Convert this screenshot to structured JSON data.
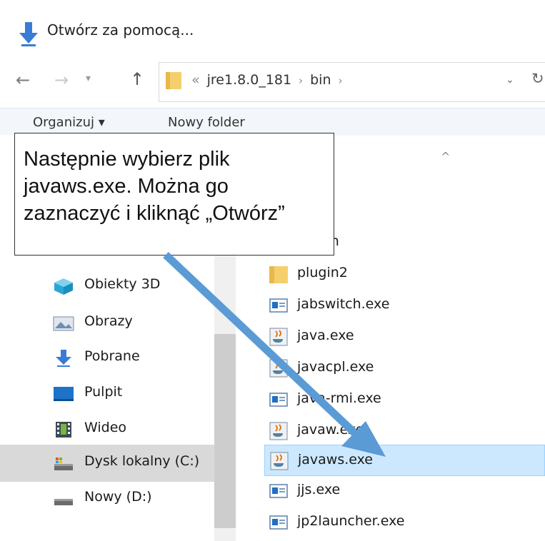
{
  "title_bar": {
    "text": "Otwórz za pomocą..."
  },
  "address": {
    "prefix": "«",
    "crumbs": [
      "jre1.8.0_181",
      "bin"
    ]
  },
  "toolbar": {
    "organize_label": "Organizuj ▾",
    "new_folder_label": "Nowy folder"
  },
  "nav_items": [
    {
      "label": "Obiekty 3D",
      "icon": "3d-objects-icon"
    },
    {
      "label": "Obrazy",
      "icon": "pictures-icon"
    },
    {
      "label": "Pobrane",
      "icon": "downloads-icon"
    },
    {
      "label": "Pulpit",
      "icon": "desktop-icon"
    },
    {
      "label": "Wideo",
      "icon": "video-icon"
    },
    {
      "label": "Dysk lokalny (C:)",
      "icon": "local-disk-icon",
      "selected": true
    },
    {
      "label": "Nowy (D:)",
      "icon": "drive-icon"
    }
  ],
  "files": [
    {
      "name": "plugin",
      "icon": "folder-icon"
    },
    {
      "name": "plugin2",
      "icon": "folder-icon"
    },
    {
      "name": "jabswitch.exe",
      "icon": "exe-icon"
    },
    {
      "name": "java.exe",
      "icon": "java-icon"
    },
    {
      "name": "javacpl.exe",
      "icon": "java-icon"
    },
    {
      "name": "java-rmi.exe",
      "icon": "exe-icon"
    },
    {
      "name": "javaw.exe",
      "icon": "java-icon"
    },
    {
      "name": "javaws.exe",
      "icon": "java-icon",
      "selected": true
    },
    {
      "name": "jjs.exe",
      "icon": "exe-icon"
    },
    {
      "name": "jp2launcher.exe",
      "icon": "exe-icon"
    }
  ],
  "callout": {
    "text": "Następnie wybierz plik javaws.exe. Można go zaznaczyć i kliknąć „Otwórz”"
  },
  "colors": {
    "arrow": "#5b9bd5",
    "selection": "#cce8ff",
    "nav_selection": "#d9d9d9"
  }
}
